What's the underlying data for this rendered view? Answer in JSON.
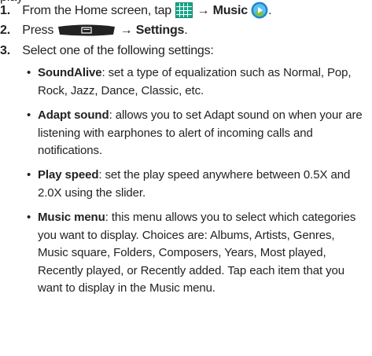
{
  "cut_line": "play",
  "steps": [
    {
      "number": "1.",
      "text_a": "From the Home screen, tap",
      "arrow": "→",
      "bold": "Music",
      "text_b": "."
    },
    {
      "number": "2.",
      "text_a": "Press",
      "arrow": "→",
      "bold": "Settings",
      "text_b": "."
    },
    {
      "number": "3.",
      "text_a": "Select one of the following settings:"
    }
  ],
  "bullets": [
    {
      "term": "SoundAlive",
      "lines": [
        ": set a type of equalization such as Normal, Pop,",
        "Rock, Jazz, Dance, Classic, etc."
      ]
    },
    {
      "term": "Adapt sound",
      "lines": [
        ": allows you to set Adapt sound on when your are",
        "listening with earphones to alert of incoming calls and",
        "notifications."
      ]
    },
    {
      "term": "Play speed",
      "lines": [
        ": set the play speed anywhere between 0.5X and",
        "2.0X using the slider."
      ]
    },
    {
      "term": "Music menu",
      "lines": [
        ": this menu allows you to select which categories",
        "you want to display. Choices are: Albums, Artists, Genres,",
        "Music square, Folders, Composers, Years, Most played,",
        "Recently played, or Recently added. Tap each item that you",
        "want to display in the Music menu."
      ]
    }
  ],
  "bullet_symbol": "•",
  "icons": {
    "apps": "apps-grid-icon",
    "music": "music-player-icon",
    "menu": "menu-key-icon"
  },
  "colors": {
    "apps_icon": "#17a589",
    "music_icon_outer": "#1f86c9",
    "menu_key": "#222222"
  }
}
